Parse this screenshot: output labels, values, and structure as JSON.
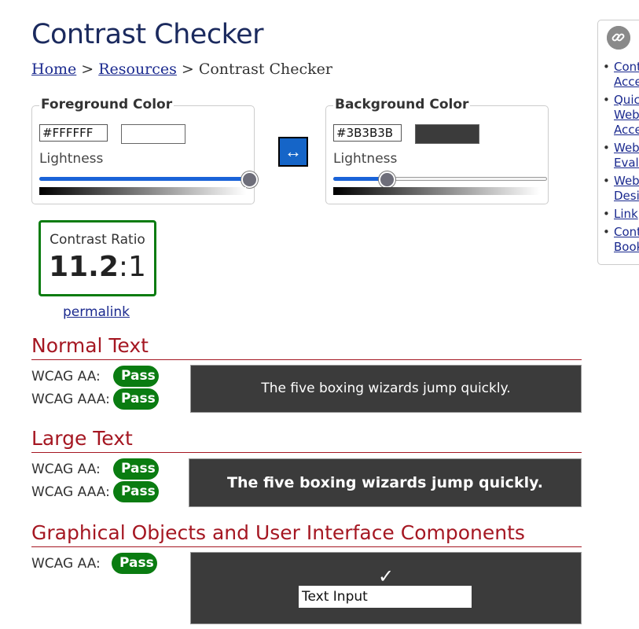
{
  "page": {
    "title": "Contrast Checker"
  },
  "breadcrumb": {
    "home": "Home",
    "resources": "Resources",
    "current": "Contrast Checker",
    "separator": ">"
  },
  "foreground": {
    "legend": "Foreground Color",
    "hex": "#FFFFFF",
    "swatch_color": "#FFFFFF",
    "lightness_label": "Lightness",
    "lightness_level": 1.0
  },
  "background": {
    "legend": "Background Color",
    "hex": "#3B3B3B",
    "swatch_color": "#3B3B3B",
    "lightness_label": "Lightness",
    "lightness_level": 0.25
  },
  "swap": {
    "icon": "swap-arrows-icon",
    "glyph": "↔",
    "color": "#1565C8"
  },
  "ratio": {
    "label": "Contrast Ratio",
    "value": "11.2",
    "suffix": ":1"
  },
  "permalink": "permalink",
  "normal_text": {
    "heading": "Normal Text",
    "aa_label": "WCAG AA:",
    "aa_result": "Pass",
    "aaa_label": "WCAG AAA:",
    "aaa_result": "Pass",
    "sample": "The five boxing wizards jump quickly."
  },
  "large_text": {
    "heading": "Large Text",
    "aa_label": "WCAG AA:",
    "aa_result": "Pass",
    "aaa_label": "WCAG AAA:",
    "aaa_result": "Pass",
    "sample": "The five boxing wizards jump quickly."
  },
  "graphical": {
    "heading": "Graphical Objects and User Interface Components",
    "aa_label": "WCAG AA:",
    "aa_result": "Pass",
    "check_glyph": "✓",
    "input_sample": "Text Input"
  },
  "colors": {
    "pass_green": "#0A7C11",
    "heading_red": "#A51722",
    "link_blue": "#1B2A8F",
    "title_navy": "#1B2A5E"
  },
  "side_panel": {
    "icon": "link-icon",
    "links": [
      "Cont",
      "Acce",
      "Quic",
      "Web",
      "Acce",
      "Web",
      "Evalu",
      "Web",
      "Desig",
      "Link",
      "Cont",
      "Book"
    ]
  }
}
